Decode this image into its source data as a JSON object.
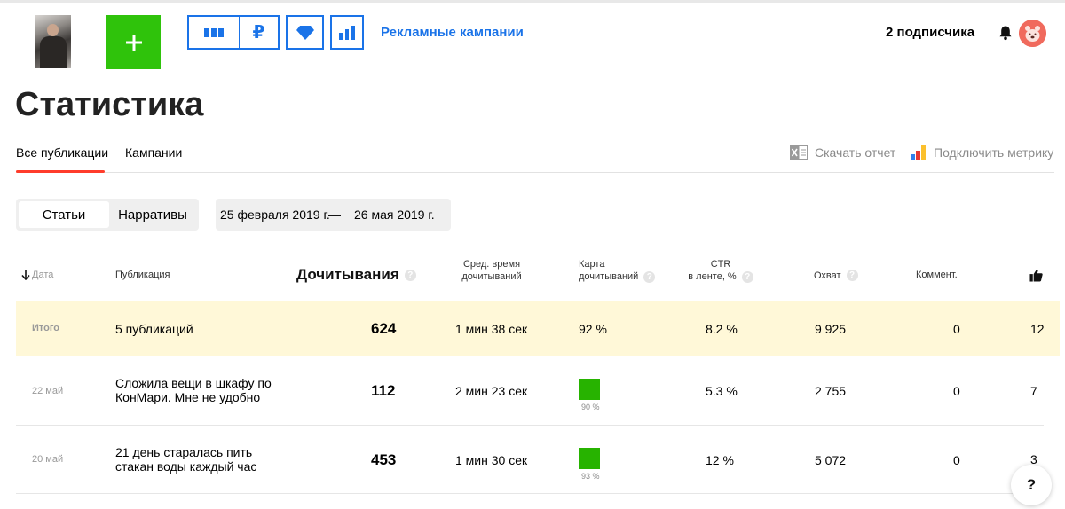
{
  "header": {
    "ads_link": "Рекламные кампании",
    "subscribers": "2 подписчика",
    "add_button": "+",
    "toolbar_icons": [
      "columns-icon",
      "ruble-icon",
      "diamond-icon",
      "bar-chart-icon"
    ],
    "ruble_symbol": "₽",
    "accent_color": "#1a73e8",
    "add_color": "#2fc30b"
  },
  "page": {
    "title": "Статистика",
    "tabs": [
      {
        "label": "Все публикации",
        "active": true
      },
      {
        "label": "Кампании",
        "active": false
      }
    ],
    "actions": {
      "download": "Скачать отчет",
      "metrics": "Подключить метрику"
    }
  },
  "filters": {
    "segments": [
      {
        "label": "Статьи",
        "selected": true
      },
      {
        "label": "Нарративы",
        "selected": false
      }
    ],
    "date_from": "25 февраля 2019 г.",
    "date_sep": "—",
    "date_to": "26 мая 2019 г."
  },
  "table": {
    "headers": {
      "date": "Дата",
      "publication": "Публикация",
      "reads": "Дочитывания",
      "avg_time_l1": "Сред. время",
      "avg_time_l2": "дочитываний",
      "map_l1": "Карта",
      "map_l2": "дочитываний",
      "ctr_l1": "CTR",
      "ctr_l2": "в ленте, %",
      "reach": "Охват",
      "comments": "Коммент.",
      "help_mark": "?"
    },
    "total": {
      "date": "Итого",
      "publication": "5 публикаций",
      "reads": "624",
      "avg_time": "1 мин 38 сек",
      "map": "92 %",
      "ctr": "8.2 %",
      "reach": "9 925",
      "comments": "0",
      "likes": "12"
    },
    "rows": [
      {
        "date": "22 май",
        "title_l1": "Сложила вещи в шкафу по",
        "title_l2": "КонМари. Мне не удобно",
        "reads": "112",
        "avg_time": "2 мин 23 сек",
        "map_pct": "90 %",
        "map_value": 0.9,
        "ctr": "5.3 %",
        "reach": "2 755",
        "comments": "0",
        "likes": "7"
      },
      {
        "date": "20 май",
        "title_l1": "21 день старалась пить",
        "title_l2": "стакан воды каждый час",
        "reads": "453",
        "avg_time": "1 мин 30 сек",
        "map_pct": "93 %",
        "map_value": 0.93,
        "ctr": "12 %",
        "reach": "5 072",
        "comments": "0",
        "likes": "3"
      }
    ]
  },
  "help_button": "?"
}
